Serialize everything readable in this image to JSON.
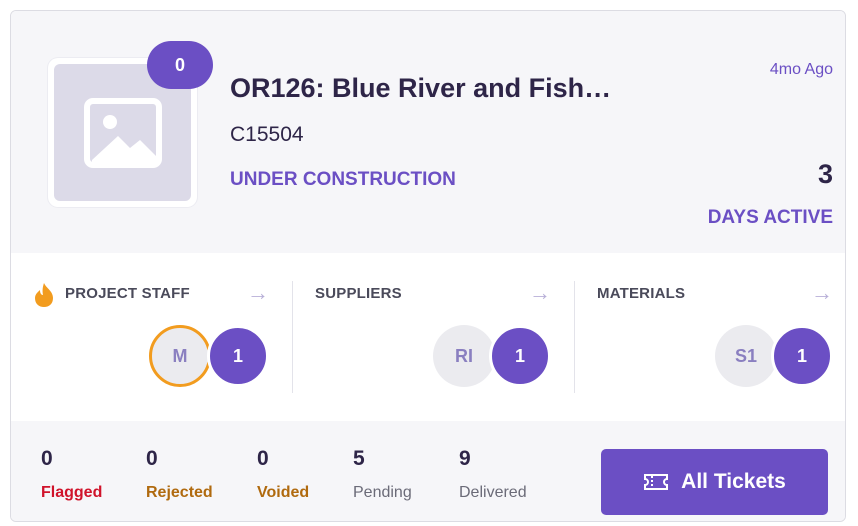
{
  "project": {
    "title": "OR126: Blue River and Fish…",
    "code": "C15504",
    "status": "UNDER CONSTRUCTION",
    "updated": "4mo Ago",
    "days_active_value": "3",
    "days_active_label": "DAYS ACTIVE",
    "badge_count": "0",
    "thumbnail_icon": "image-placeholder-icon"
  },
  "sections": [
    {
      "title": "PROJECT STAFF",
      "icon": "flame-icon",
      "avatar_initials": "M",
      "count": "1"
    },
    {
      "title": "SUPPLIERS",
      "avatar_initials": "RI",
      "count": "1"
    },
    {
      "title": "MATERIALS",
      "avatar_initials": "S1",
      "count": "1"
    }
  ],
  "stats": [
    {
      "value": "0",
      "label": "Flagged"
    },
    {
      "value": "0",
      "label": "Rejected"
    },
    {
      "value": "0",
      "label": "Voided"
    },
    {
      "value": "5",
      "label": "Pending"
    },
    {
      "value": "9",
      "label": "Delivered"
    }
  ],
  "actions": {
    "all_tickets_label": "All Tickets",
    "all_tickets_icon": "ticket-icon"
  },
  "colors": {
    "accent": "#6b4fc4",
    "flagged": "#d0132b",
    "rejected": "#b06a0f",
    "staff_ring": "#f29c1f"
  }
}
